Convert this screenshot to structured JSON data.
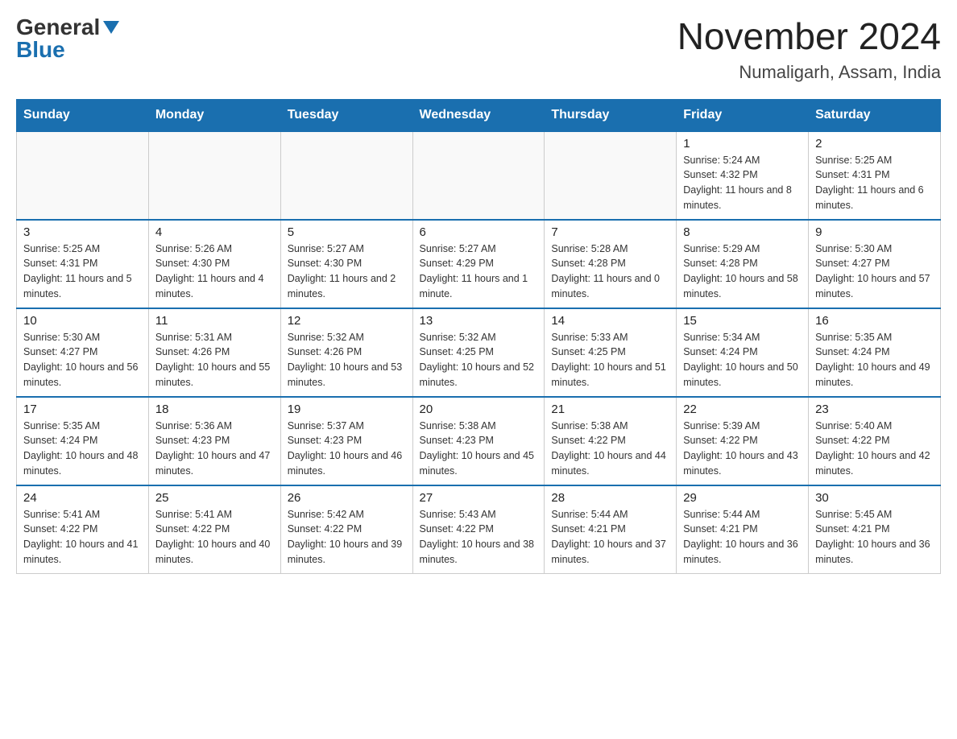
{
  "header": {
    "logo_general": "General",
    "logo_blue": "Blue",
    "month_title": "November 2024",
    "location": "Numaligarh, Assam, India"
  },
  "weekdays": [
    "Sunday",
    "Monday",
    "Tuesday",
    "Wednesday",
    "Thursday",
    "Friday",
    "Saturday"
  ],
  "weeks": [
    [
      {
        "day": "",
        "info": ""
      },
      {
        "day": "",
        "info": ""
      },
      {
        "day": "",
        "info": ""
      },
      {
        "day": "",
        "info": ""
      },
      {
        "day": "",
        "info": ""
      },
      {
        "day": "1",
        "info": "Sunrise: 5:24 AM\nSunset: 4:32 PM\nDaylight: 11 hours and 8 minutes."
      },
      {
        "day": "2",
        "info": "Sunrise: 5:25 AM\nSunset: 4:31 PM\nDaylight: 11 hours and 6 minutes."
      }
    ],
    [
      {
        "day": "3",
        "info": "Sunrise: 5:25 AM\nSunset: 4:31 PM\nDaylight: 11 hours and 5 minutes."
      },
      {
        "day": "4",
        "info": "Sunrise: 5:26 AM\nSunset: 4:30 PM\nDaylight: 11 hours and 4 minutes."
      },
      {
        "day": "5",
        "info": "Sunrise: 5:27 AM\nSunset: 4:30 PM\nDaylight: 11 hours and 2 minutes."
      },
      {
        "day": "6",
        "info": "Sunrise: 5:27 AM\nSunset: 4:29 PM\nDaylight: 11 hours and 1 minute."
      },
      {
        "day": "7",
        "info": "Sunrise: 5:28 AM\nSunset: 4:28 PM\nDaylight: 11 hours and 0 minutes."
      },
      {
        "day": "8",
        "info": "Sunrise: 5:29 AM\nSunset: 4:28 PM\nDaylight: 10 hours and 58 minutes."
      },
      {
        "day": "9",
        "info": "Sunrise: 5:30 AM\nSunset: 4:27 PM\nDaylight: 10 hours and 57 minutes."
      }
    ],
    [
      {
        "day": "10",
        "info": "Sunrise: 5:30 AM\nSunset: 4:27 PM\nDaylight: 10 hours and 56 minutes."
      },
      {
        "day": "11",
        "info": "Sunrise: 5:31 AM\nSunset: 4:26 PM\nDaylight: 10 hours and 55 minutes."
      },
      {
        "day": "12",
        "info": "Sunrise: 5:32 AM\nSunset: 4:26 PM\nDaylight: 10 hours and 53 minutes."
      },
      {
        "day": "13",
        "info": "Sunrise: 5:32 AM\nSunset: 4:25 PM\nDaylight: 10 hours and 52 minutes."
      },
      {
        "day": "14",
        "info": "Sunrise: 5:33 AM\nSunset: 4:25 PM\nDaylight: 10 hours and 51 minutes."
      },
      {
        "day": "15",
        "info": "Sunrise: 5:34 AM\nSunset: 4:24 PM\nDaylight: 10 hours and 50 minutes."
      },
      {
        "day": "16",
        "info": "Sunrise: 5:35 AM\nSunset: 4:24 PM\nDaylight: 10 hours and 49 minutes."
      }
    ],
    [
      {
        "day": "17",
        "info": "Sunrise: 5:35 AM\nSunset: 4:24 PM\nDaylight: 10 hours and 48 minutes."
      },
      {
        "day": "18",
        "info": "Sunrise: 5:36 AM\nSunset: 4:23 PM\nDaylight: 10 hours and 47 minutes."
      },
      {
        "day": "19",
        "info": "Sunrise: 5:37 AM\nSunset: 4:23 PM\nDaylight: 10 hours and 46 minutes."
      },
      {
        "day": "20",
        "info": "Sunrise: 5:38 AM\nSunset: 4:23 PM\nDaylight: 10 hours and 45 minutes."
      },
      {
        "day": "21",
        "info": "Sunrise: 5:38 AM\nSunset: 4:22 PM\nDaylight: 10 hours and 44 minutes."
      },
      {
        "day": "22",
        "info": "Sunrise: 5:39 AM\nSunset: 4:22 PM\nDaylight: 10 hours and 43 minutes."
      },
      {
        "day": "23",
        "info": "Sunrise: 5:40 AM\nSunset: 4:22 PM\nDaylight: 10 hours and 42 minutes."
      }
    ],
    [
      {
        "day": "24",
        "info": "Sunrise: 5:41 AM\nSunset: 4:22 PM\nDaylight: 10 hours and 41 minutes."
      },
      {
        "day": "25",
        "info": "Sunrise: 5:41 AM\nSunset: 4:22 PM\nDaylight: 10 hours and 40 minutes."
      },
      {
        "day": "26",
        "info": "Sunrise: 5:42 AM\nSunset: 4:22 PM\nDaylight: 10 hours and 39 minutes."
      },
      {
        "day": "27",
        "info": "Sunrise: 5:43 AM\nSunset: 4:22 PM\nDaylight: 10 hours and 38 minutes."
      },
      {
        "day": "28",
        "info": "Sunrise: 5:44 AM\nSunset: 4:21 PM\nDaylight: 10 hours and 37 minutes."
      },
      {
        "day": "29",
        "info": "Sunrise: 5:44 AM\nSunset: 4:21 PM\nDaylight: 10 hours and 36 minutes."
      },
      {
        "day": "30",
        "info": "Sunrise: 5:45 AM\nSunset: 4:21 PM\nDaylight: 10 hours and 36 minutes."
      }
    ]
  ]
}
